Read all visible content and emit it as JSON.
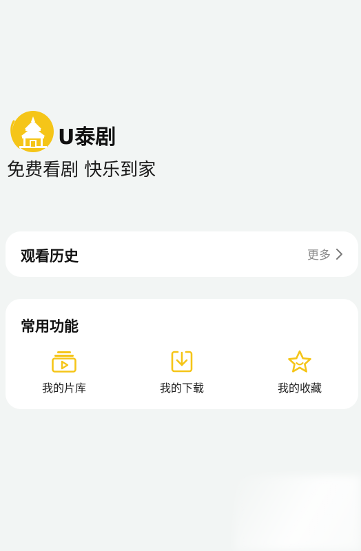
{
  "brand": {
    "app_name": "U泰剧",
    "slogan": "免费看剧 快乐到家",
    "logo_icon": "temple-logo-icon",
    "logo_color": "#f5c518"
  },
  "history": {
    "title": "观看历史",
    "more_label": "更多",
    "more_icon": "chevron-right-icon"
  },
  "functions": {
    "title": "常用功能",
    "items": [
      {
        "label": "我的片库",
        "icon": "video-library-icon"
      },
      {
        "label": "我的下载",
        "icon": "download-icon"
      },
      {
        "label": "我的收藏",
        "icon": "star-icon"
      }
    ]
  },
  "colors": {
    "background": "#f2f5f4",
    "card": "#ffffff",
    "accent": "#f5c518",
    "muted_text": "#8a8a8a"
  }
}
